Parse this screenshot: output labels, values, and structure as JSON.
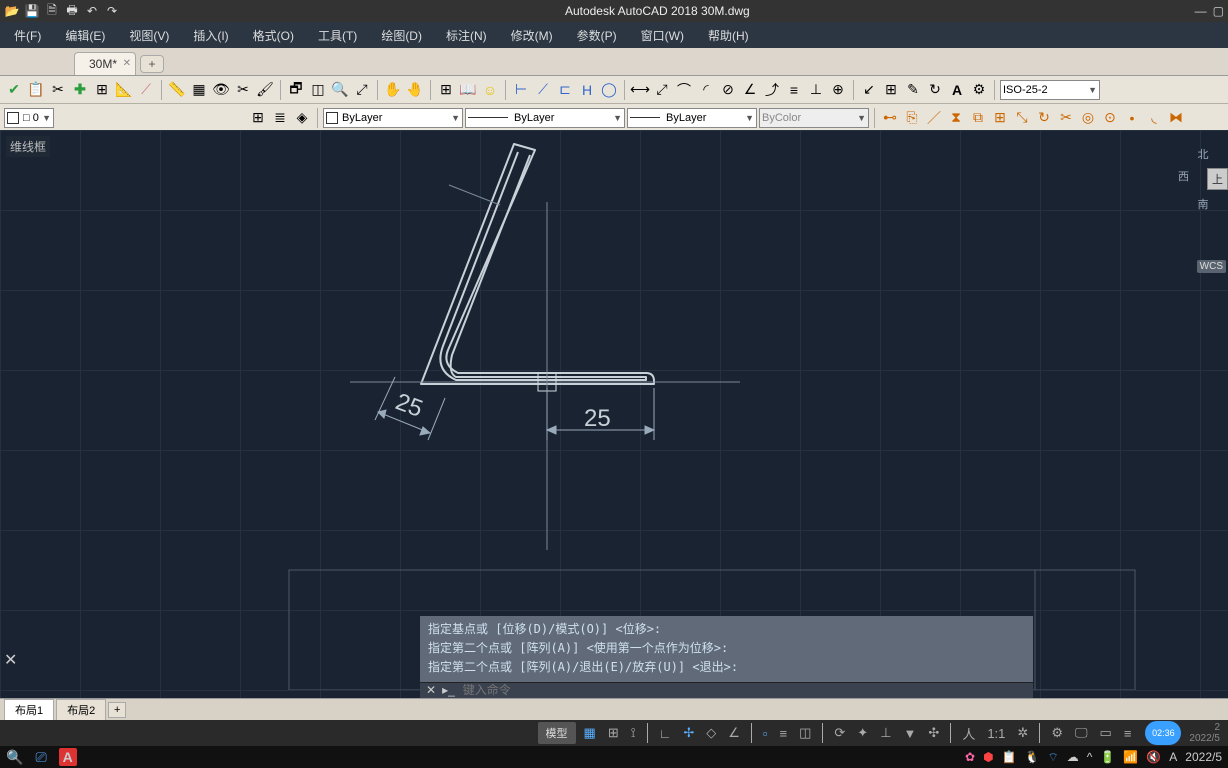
{
  "app": {
    "title": "Autodesk AutoCAD 2018   30M.dwg"
  },
  "menu": [
    "件(F)",
    "编辑(E)",
    "视图(V)",
    "插入(I)",
    "格式(O)",
    "工具(T)",
    "绘图(D)",
    "标注(N)",
    "修改(M)",
    "参数(P)",
    "窗口(W)",
    "帮助(H)"
  ],
  "tabs": {
    "file": "30M*",
    "newtab": "+"
  },
  "layer": {
    "color_label": "□ 0",
    "layer_name": "ByLayer",
    "linetype": "ByLayer",
    "lineweight": "ByLayer",
    "plotstyle": "ByColor",
    "dimstyle": "ISO-25-2"
  },
  "canvas": {
    "panel_label": "维线框",
    "cube_labels": {
      "n": "北",
      "w": "西",
      "s": "南",
      "wcs": "WCS"
    },
    "dimensions": {
      "d1": "25",
      "d2": "25"
    }
  },
  "command": {
    "line1": "指定基点或 [位移(D)/模式(O)] <位移>:",
    "line2": "指定第二个点或 [阵列(A)] <使用第一个点作为位移>:",
    "line3": "指定第二个点或 [阵列(A)/退出(E)/放弃(U)] <退出>:",
    "prompt_placeholder": "键入命令"
  },
  "layout_tabs": [
    "布局1",
    "布局2"
  ],
  "status": {
    "model": "模型",
    "scale": "1:1",
    "clock": "02:36",
    "date": "2022/5",
    "extra": "2"
  },
  "tray": {
    "date": "2022/5"
  }
}
